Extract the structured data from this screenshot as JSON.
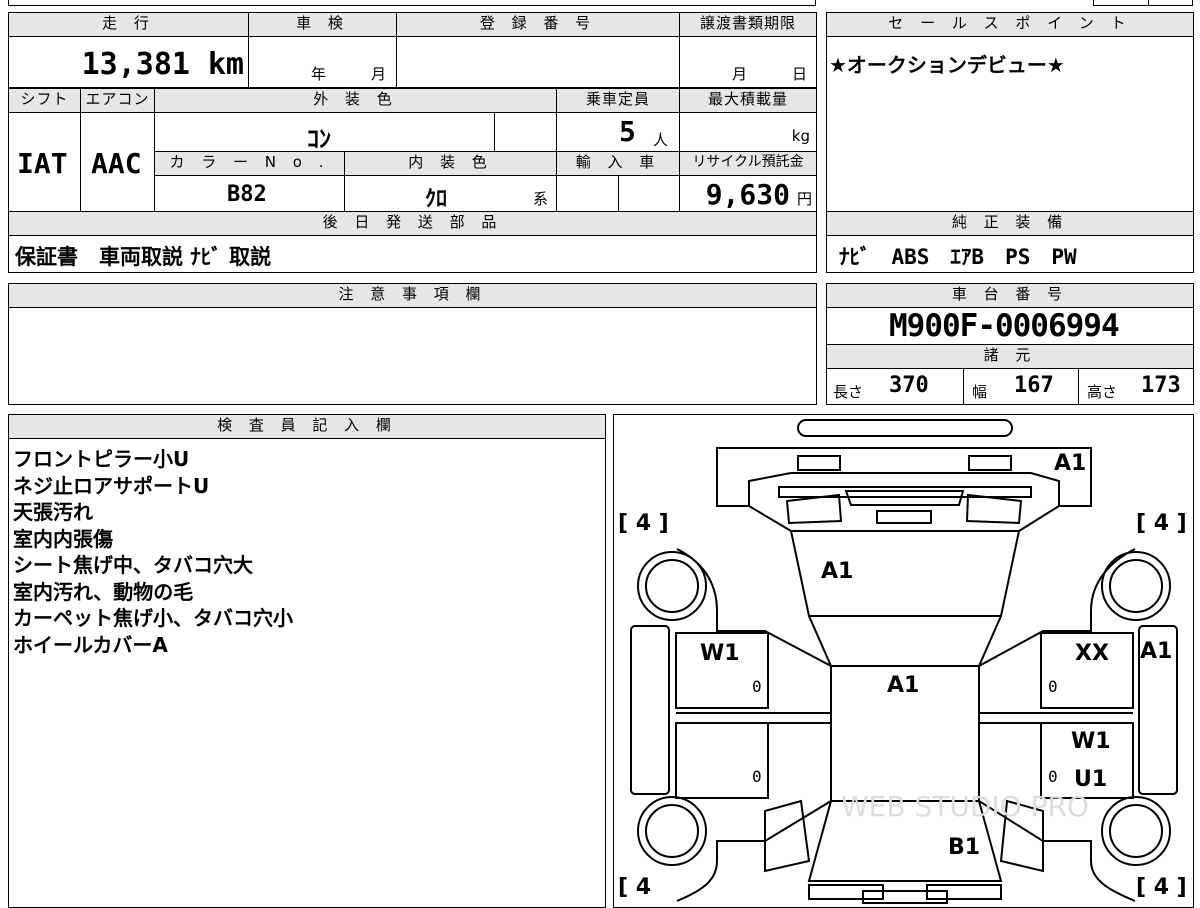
{
  "top": {
    "mileage_label": "走 行",
    "mileage_value": "13,381",
    "mileage_unit": "km",
    "shaken_label": "車 検",
    "shaken_year": "年",
    "shaken_month": "月",
    "registration_label": "登 録 番 号",
    "transfer_label": "譲渡書類期限",
    "transfer_month": "月",
    "transfer_day": "日"
  },
  "row2": {
    "shift_label": "シフト",
    "aircon_label": "エアコン",
    "exterior_label": "外 装 色",
    "capacity_label": "乗車定員",
    "maxload_label": "最大積載量",
    "shift_value": "IAT",
    "aircon_value": "AAC",
    "exterior_value": "ｺﾝ",
    "capacity_value": "5",
    "capacity_unit": "人",
    "maxload_unit": "kg",
    "color_no_label": "カ ラ ー N o .",
    "interior_label": "内 装 色",
    "import_label": "輸 入 車",
    "recycle_label": "リサイクル預託金",
    "color_no_value": "B82",
    "interior_value": "ｸﾛ",
    "interior_suffix": "系",
    "recycle_value": "9,630",
    "recycle_unit": "円"
  },
  "sales": {
    "label": "セ ー ル ス ポ イ ン ト",
    "text": "★オークションデビュー★"
  },
  "parts": {
    "label": "後 日 発 送 部 品",
    "text": "保証書　車両取説 ﾅﾋﾞ 取説"
  },
  "equipment": {
    "label": "純 正 装 備",
    "text": "ﾅﾋﾞ　ABS　ｴｱB　PS　PW"
  },
  "notes": {
    "label": "注 意 事 項 欄"
  },
  "chassis": {
    "label": "車 台 番 号",
    "value": "M900F-0006994",
    "spec_label": "諸 元",
    "length_label": "長さ",
    "length_value": "370",
    "width_label": "幅",
    "width_value": "167",
    "height_label": "高さ",
    "height_value": "173"
  },
  "inspector": {
    "label": "検 査 員 記 入 欄",
    "lines": [
      "フロントピラー小U",
      "ネジ止ロアサポートU",
      "天張汚れ",
      "室内内張傷",
      "シート焦げ中、タバコ穴大",
      "室内汚れ、動物の毛",
      "カーペット焦げ小、タバコ穴小",
      "ホイールカバーA"
    ]
  },
  "diagram": {
    "marks": {
      "front_right": "A1",
      "windshield": "A1",
      "roof": "A1",
      "left_front_door": "W1",
      "right_front_door": "XX",
      "right_side": "A1",
      "right_rear_door_1": "W1",
      "right_rear_door_2": "U1",
      "rear": "B1",
      "zero": "0"
    },
    "tire_tl": "[ 4 ]",
    "tire_tr": "[ 4 ]",
    "tire_bl": "[ 4",
    "tire_br": "[ 4 ]",
    "watermark": "WEB STUDIO PRO"
  }
}
